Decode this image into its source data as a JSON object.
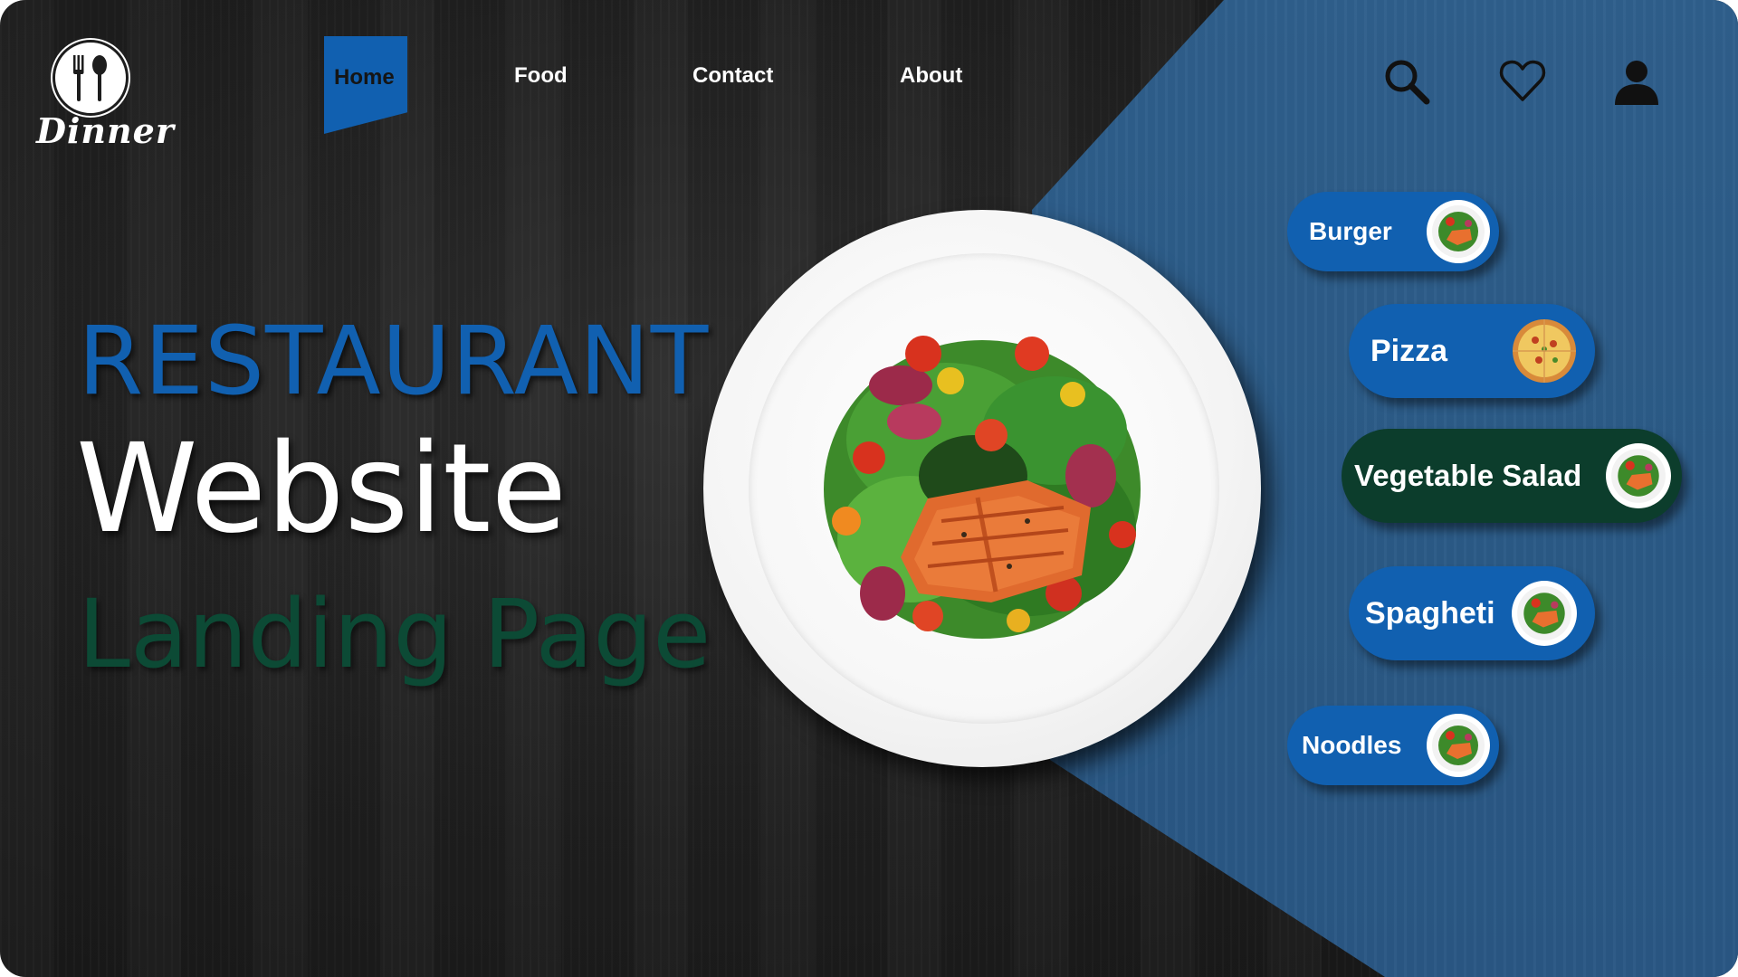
{
  "brand": {
    "name": "Dinner"
  },
  "nav": {
    "items": [
      {
        "label": "Home",
        "active": true
      },
      {
        "label": "Food"
      },
      {
        "label": "Contact"
      },
      {
        "label": "About"
      }
    ],
    "active_color": "#1160b0"
  },
  "header_icons": [
    "search-icon",
    "heart-icon",
    "user-icon"
  ],
  "hero": {
    "line1": "RESTAURANT",
    "line2": "Website",
    "line3": "Landing Page"
  },
  "menu": {
    "items": [
      {
        "label": "Burger",
        "thumb": "salmon-salad",
        "selected": false
      },
      {
        "label": "Pizza",
        "thumb": "pizza",
        "selected": false
      },
      {
        "label": "Vegetable Salad",
        "thumb": "salmon-salad",
        "selected": true
      },
      {
        "label": "Spagheti",
        "thumb": "salmon-salad",
        "selected": false
      },
      {
        "label": "Noodles",
        "thumb": "salmon-salad",
        "selected": false
      }
    ]
  },
  "colors": {
    "accent_blue": "#1160b0",
    "panel_blue": "#2d5c88",
    "selected_green": "#0c3d2c",
    "hero_green": "#0c4a35",
    "background_dark": "#222222"
  }
}
